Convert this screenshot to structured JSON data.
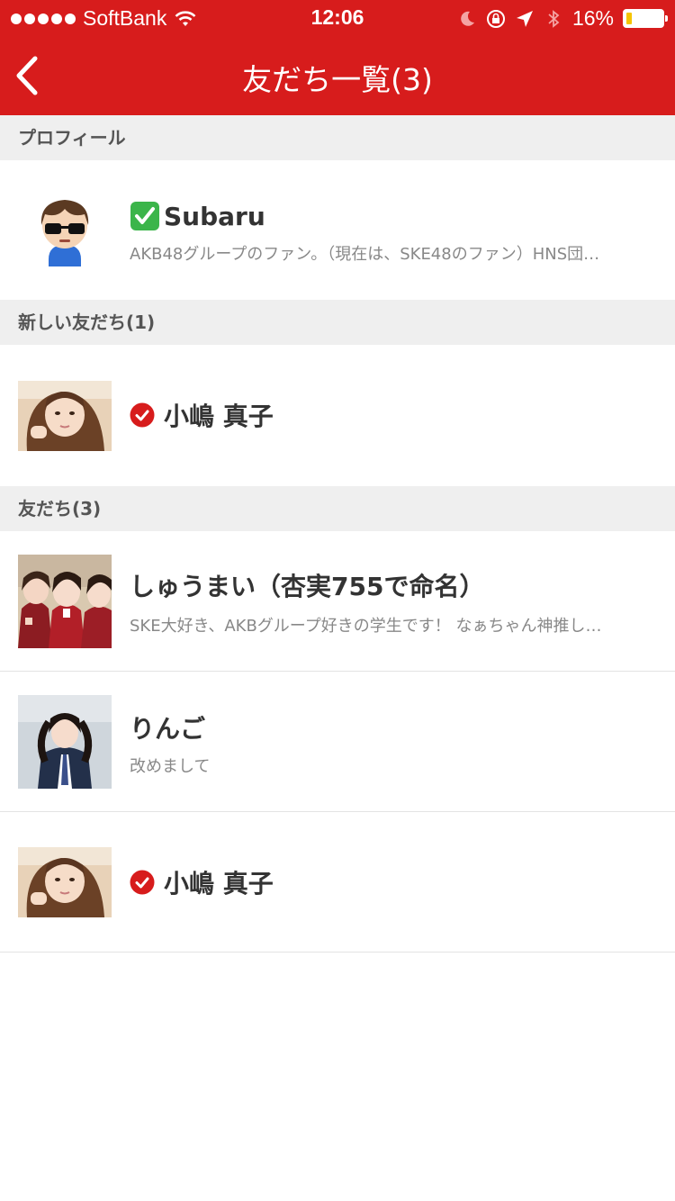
{
  "status_bar": {
    "carrier": "SoftBank",
    "time": "12:06",
    "battery_percent": "16%",
    "battery_level": 0.16
  },
  "nav": {
    "title": "友だち一覧(3)"
  },
  "sections": {
    "profile_header": "プロフィール",
    "new_friends_header": "新しい友だち(1)",
    "friends_header": "友だち(3)"
  },
  "profile": {
    "name": "Subaru",
    "description": "AKB48グループのファン。（現在は、SKE48のファン）HNS団…"
  },
  "new_friends": [
    {
      "name": "小嶋 真子",
      "verified": true
    }
  ],
  "friends": [
    {
      "name": "しゅうまい（杏実755で命名）",
      "description": "SKE大好き、AKBグループ好きの学生です！ なぁちゃん神推し…"
    },
    {
      "name": "りんご",
      "description": "改めまして"
    },
    {
      "name": "小嶋 真子",
      "verified": true
    }
  ],
  "colors": {
    "accent": "#d71c1c",
    "section_bg": "#efefef"
  }
}
